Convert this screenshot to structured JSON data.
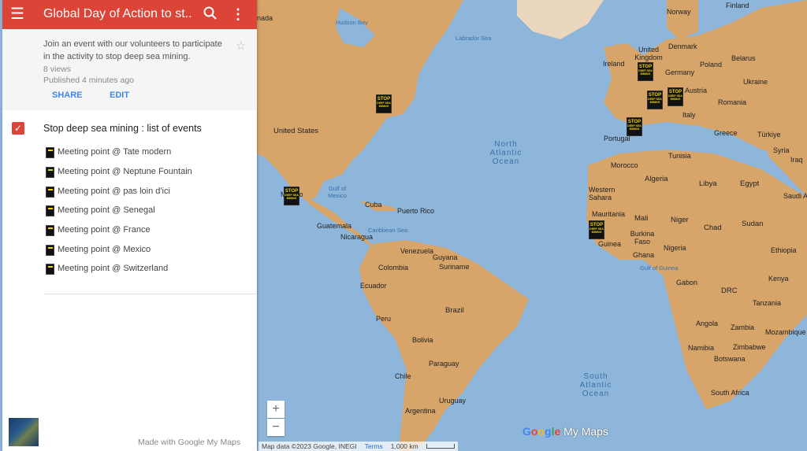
{
  "header": {
    "title": "Global Day of Action to st...",
    "menu_icon": "menu-icon",
    "search_icon": "search-icon",
    "more_icon": "more-vert-icon",
    "color": "#db4437"
  },
  "info": {
    "description": "Join an event with our volunteers to participate in the activity to stop deep sea mining.",
    "views": "8 views",
    "published": "Published 4 minutes ago",
    "share_label": "SHARE",
    "edit_label": "EDIT"
  },
  "layer": {
    "title": "Stop deep sea mining : list of events",
    "checked": true,
    "items": [
      {
        "label": "Meeting point @ Tate modern"
      },
      {
        "label": "Meeting point @ Neptune Fountain"
      },
      {
        "label": "Meeting point @ pas loin d'ici"
      },
      {
        "label": "Meeting point @ Senegal"
      },
      {
        "label": "Meeting point @ France"
      },
      {
        "label": "Meeting point @ Mexico"
      },
      {
        "label": "Meeting point @ Switzerland"
      }
    ]
  },
  "footer": {
    "made_with": "Made with Google My Maps"
  },
  "map": {
    "zoom_in": "+",
    "zoom_out": "−",
    "logo_google": [
      "G",
      "o",
      "o",
      "g",
      "l",
      "e"
    ],
    "logo_mymaps": "My Maps",
    "attribution": "Map data ©2023 Google, INEGI",
    "terms": "Terms",
    "scale": "1,000 km",
    "marker_text_1": "STOP",
    "marker_text_2": "DEEP SEA MINING",
    "labels": {
      "canada": "nada",
      "hudson_bay": "Hudson Bay",
      "labrador_sea": "Labrador Sea",
      "norway": "Norway",
      "finland": "Finland",
      "united_kingdom": "United Kingdom",
      "denmark": "Denmark",
      "ireland": "Ireland",
      "belarus": "Belarus",
      "poland": "Poland",
      "germany": "Germany",
      "ukraine": "Ukraine",
      "austria": "Austria",
      "romania": "Romania",
      "italy": "Italy",
      "portugal": "Portugal",
      "greece": "Greece",
      "turkiye": "Türkiye",
      "syria": "Syria",
      "iraq": "Iraq",
      "tunisia": "Tunisia",
      "morocco": "Morocco",
      "algeria": "Algeria",
      "libya": "Libya",
      "egypt": "Egypt",
      "saudi": "Saudi A",
      "western_sahara": "Western Sahara",
      "mauritania": "Mauritania",
      "mali": "Mali",
      "niger": "Niger",
      "chad": "Chad",
      "sudan": "Sudan",
      "burkina": "Burkina Faso",
      "guinea": "Guinea",
      "ghana": "Ghana",
      "nigeria": "Nigeria",
      "ethiopia": "Ethiopia",
      "gulf_guinea": "Gulf of Guinea",
      "gabon": "Gabon",
      "drc": "DRC",
      "kenya": "Kenya",
      "tanzania": "Tanzania",
      "angola": "Angola",
      "zambia": "Zambia",
      "mozambique": "Mozambique",
      "namibia": "Namibia",
      "zimbabwe": "Zimbabwe",
      "botswana": "Botswana",
      "south_africa": "South Africa",
      "united_states": "United States",
      "gulf_mexico": "Gulf of Mexico",
      "mexico": "Mexico",
      "cuba": "Cuba",
      "puerto_rico": "Puerto Rico",
      "guatemala": "Guatemala",
      "nicaragua": "Nicaragua",
      "caribbean": "Caribbean Sea",
      "venezuela": "Venezuela",
      "guyana": "Guyana",
      "suriname": "Suriname",
      "colombia": "Colombia",
      "ecuador": "Ecuador",
      "peru": "Peru",
      "brazil": "Brazil",
      "bolivia": "Bolivia",
      "paraguay": "Paraguay",
      "chile": "Chile",
      "uruguay": "Uruguay",
      "argentina": "Argentina",
      "north_atlantic": "North Atlantic Ocean",
      "south_atlantic": "South Atlantic Ocean"
    }
  }
}
